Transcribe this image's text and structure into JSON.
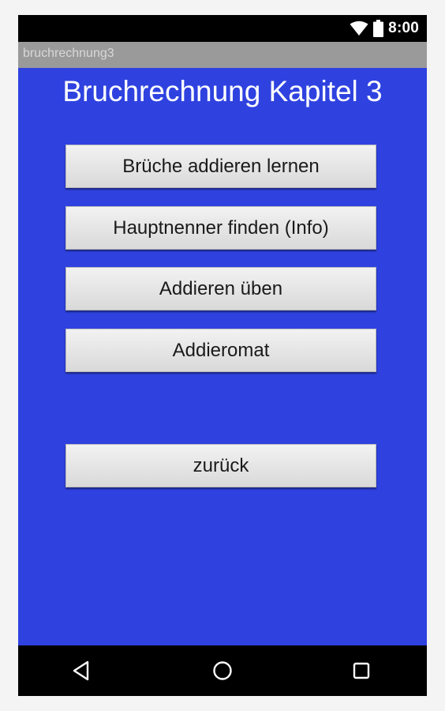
{
  "status_bar": {
    "time": "8:00",
    "icons": [
      "wifi-icon",
      "battery-icon"
    ]
  },
  "app": {
    "title": "bruchrechnung3"
  },
  "main": {
    "heading": "Bruchrechnung Kapitel 3",
    "buttons": [
      {
        "label": "Brüche addieren lernen"
      },
      {
        "label": "Hauptnenner finden  (Info)"
      },
      {
        "label": "Addieren üben"
      },
      {
        "label": "Addieromat"
      },
      {
        "label": "zurück"
      }
    ],
    "background_color": "#2f42e0"
  },
  "nav_bar": {
    "icons": [
      "back-icon",
      "home-icon",
      "recents-icon"
    ]
  }
}
